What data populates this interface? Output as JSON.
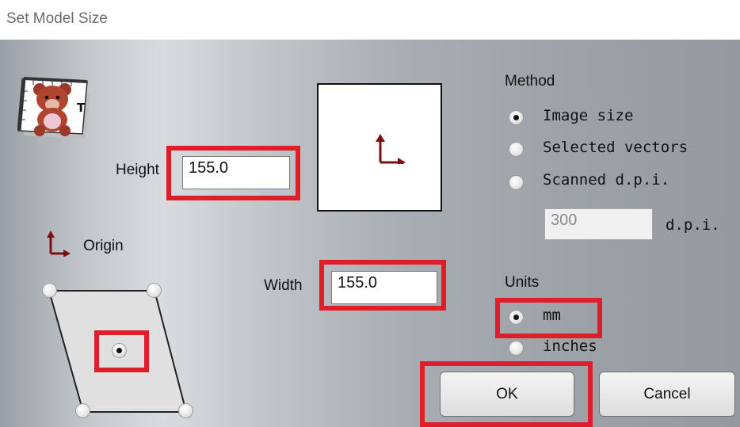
{
  "window": {
    "title": "Set Model Size"
  },
  "height": {
    "label": "Height",
    "value": "155.0"
  },
  "width": {
    "label": "Width",
    "value": "155.0"
  },
  "origin": {
    "label": "Origin",
    "selected": "center"
  },
  "method": {
    "label": "Method",
    "options": [
      "Image size",
      "Selected vectors",
      "Scanned d.p.i."
    ],
    "selected": "Image size",
    "dpi_value": "300",
    "dpi_unit": "d.p.i."
  },
  "units": {
    "label": "Units",
    "options": [
      "mm",
      "inches"
    ],
    "selected": "mm"
  },
  "buttons": {
    "ok": "OK",
    "cancel": "Cancel"
  },
  "colors": {
    "highlight": "#e01e2a",
    "origin_arrow": "#7a1010"
  }
}
